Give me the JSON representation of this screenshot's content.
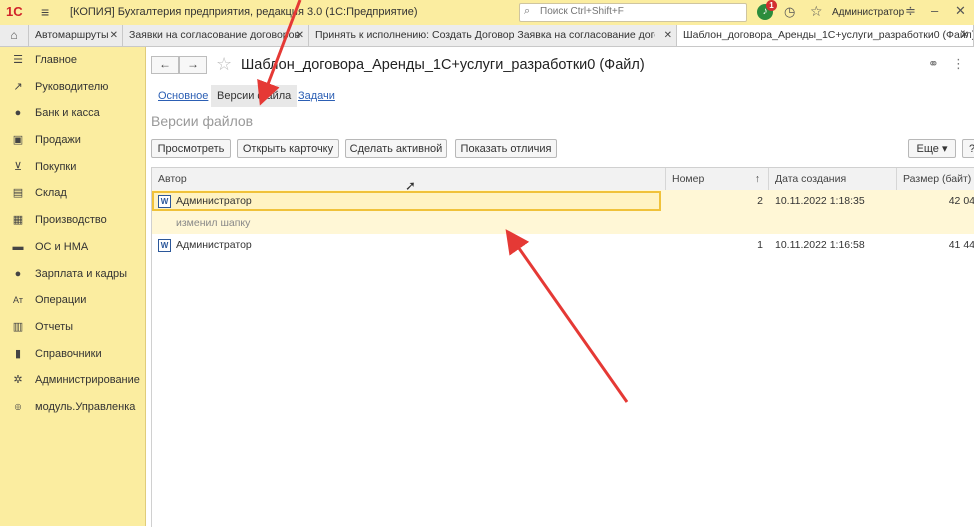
{
  "app": {
    "logo": "1С",
    "title": "[КОПИЯ] Бухгалтерия предприятия, редакция 3.0  (1С:Предприятие)",
    "search_placeholder": "Поиск Ctrl+Shift+F",
    "notifications_count": "1",
    "user": "Администратор"
  },
  "window_tabs": [
    {
      "label": "Автомаршруты"
    },
    {
      "label": "Заявки на согласование договоров"
    },
    {
      "label": "Принять к исполнению: Создать Договор Заявка на согласование договора"
    },
    {
      "label": "Шаблон_договора_Аренды_1С+услуги_разработки0 (Файл)"
    }
  ],
  "sidebar": {
    "items": [
      {
        "label": "Главное",
        "icon": "menu-icon"
      },
      {
        "label": "Руководителю",
        "icon": "trend-icon"
      },
      {
        "label": "Банк и касса",
        "icon": "bank-icon"
      },
      {
        "label": "Продажи",
        "icon": "sales-icon"
      },
      {
        "label": "Покупки",
        "icon": "cart-icon"
      },
      {
        "label": "Склад",
        "icon": "warehouse-icon"
      },
      {
        "label": "Производство",
        "icon": "production-icon"
      },
      {
        "label": "ОС и НМА",
        "icon": "truck-icon"
      },
      {
        "label": "Зарплата и кадры",
        "icon": "person-icon"
      },
      {
        "label": "Операции",
        "icon": "operations-icon"
      },
      {
        "label": "Отчеты",
        "icon": "reports-icon"
      },
      {
        "label": "Справочники",
        "icon": "books-icon"
      },
      {
        "label": "Администрирование",
        "icon": "gear-icon"
      },
      {
        "label": "модуль.Управленка",
        "icon": "module-icon"
      }
    ]
  },
  "form": {
    "title": "Шаблон_договора_Аренды_1С+услуги_разработки0 (Файл)",
    "tabs": {
      "main": "Основное",
      "versions": "Версии файла",
      "tasks": "Задачи"
    },
    "section_title": "Версии файлов",
    "buttons": {
      "view": "Просмотреть",
      "open_card": "Открыть карточку",
      "make_active": "Сделать активной",
      "show_diff": "Показать отличия",
      "more": "Еще ▾",
      "help": "?"
    },
    "table": {
      "headers": {
        "author": "Автор",
        "number": "Номер",
        "created": "Дата создания",
        "size": "Размер (байт)"
      },
      "rows": [
        {
          "author": "Администратор",
          "number": "2",
          "created": "10.11.2022 1:18:35",
          "size": "42 04",
          "comment": "изменил шапку"
        },
        {
          "author": "Администратор",
          "number": "1",
          "created": "10.11.2022 1:16:58",
          "size": "41 44"
        }
      ]
    }
  },
  "colors": {
    "sidebar_bg": "#fbeda0",
    "annotation_arrow": "#e53935",
    "selection": "#f0c23a",
    "link": "#2c5fb4"
  }
}
